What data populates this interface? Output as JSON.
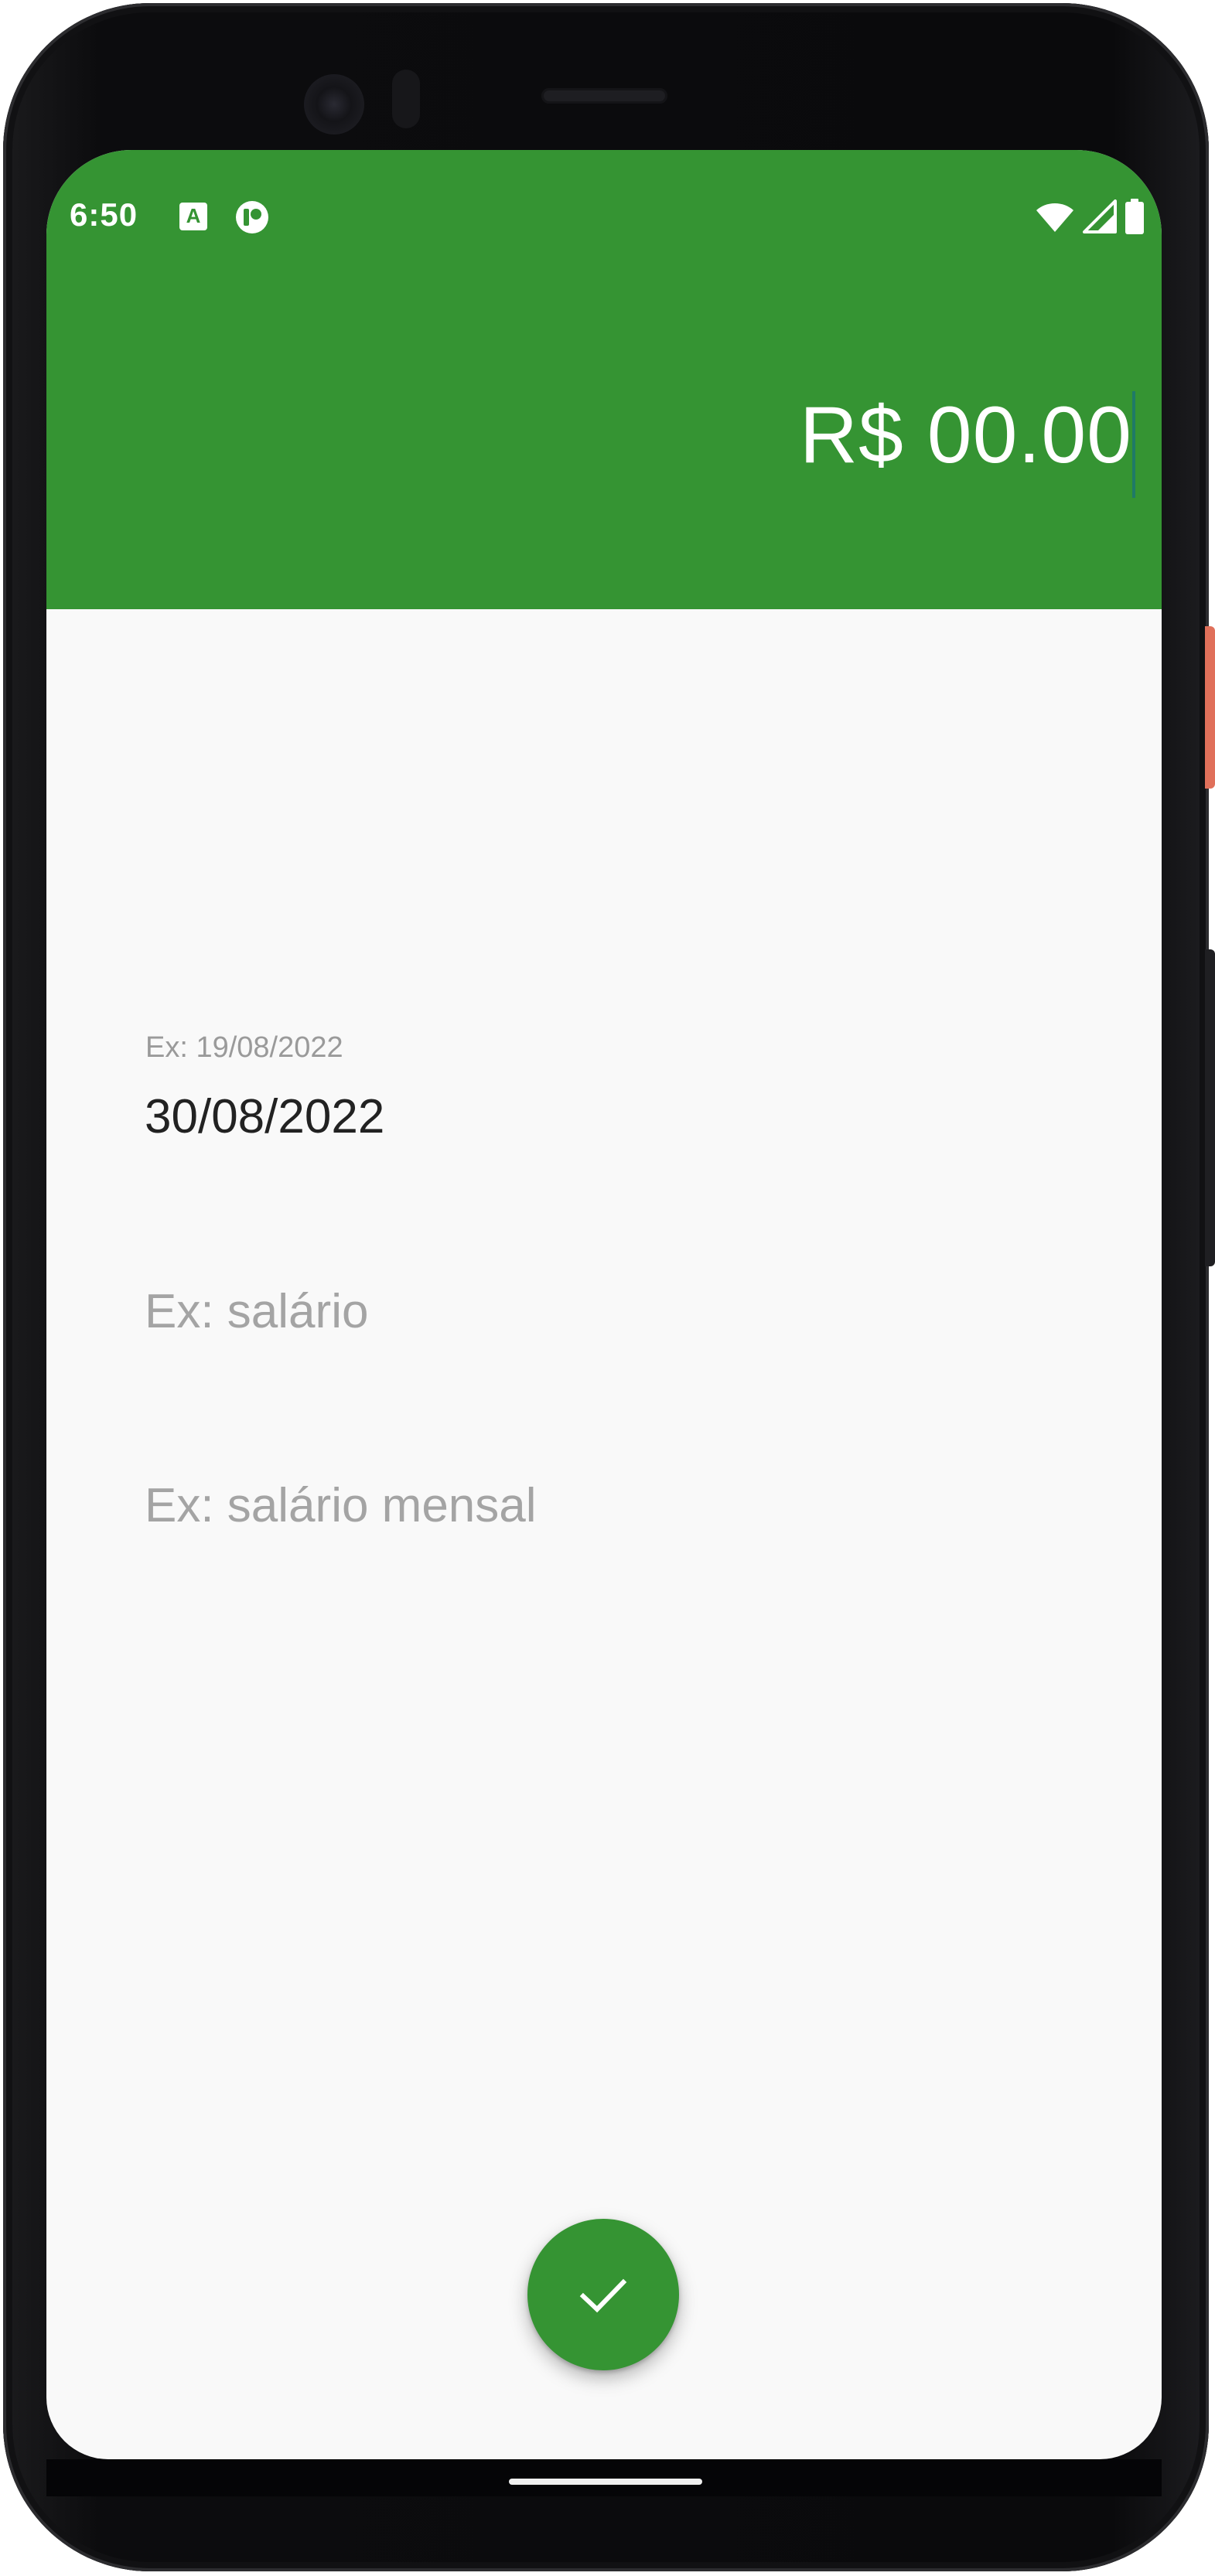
{
  "status_bar": {
    "time": "6:50",
    "left_icons": [
      "a-badge-icon",
      "record-icon"
    ],
    "right_icons": [
      "wifi-icon",
      "signal-icon",
      "battery-icon"
    ]
  },
  "header": {
    "amount": "R$ 00.00"
  },
  "form": {
    "date_hint": "Ex: 19/08/2022",
    "date_value": "30/08/2022",
    "category_placeholder": "Ex: salário",
    "description_placeholder": "Ex: salário mensal"
  },
  "fab": {
    "icon": "check-icon"
  },
  "colors": {
    "primary": "#359433",
    "background": "#f9f9f9",
    "hint_text": "#a4a4a4",
    "value_text": "#222222"
  }
}
